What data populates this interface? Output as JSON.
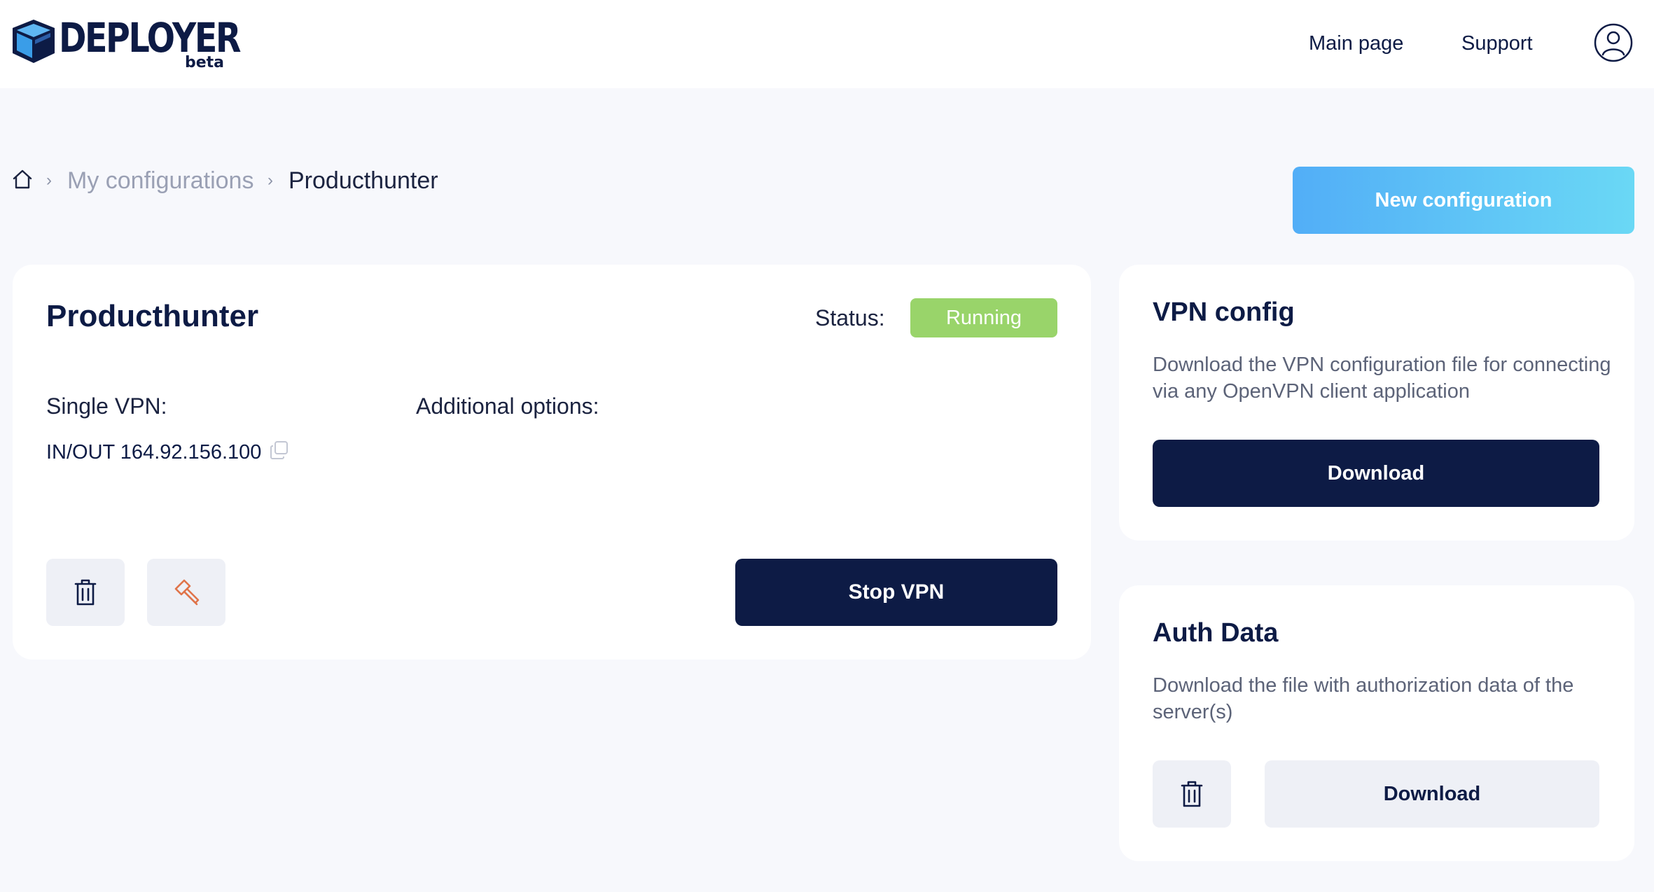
{
  "header": {
    "logo_text": "DEPLOYER",
    "logo_badge": "beta",
    "nav": [
      {
        "label": "Main page"
      },
      {
        "label": "Support"
      }
    ],
    "user_icon": "user-circle-icon"
  },
  "breadcrumb": {
    "home_icon": "home-icon",
    "items": [
      {
        "label": "My configurations"
      },
      {
        "label": "Producthunter"
      }
    ],
    "separator": "›"
  },
  "actions": {
    "new_configuration_label": "New configuration"
  },
  "configuration": {
    "name": "Producthunter",
    "status_label": "Status:",
    "status_value": "Running",
    "status_color": "#99d46a",
    "single_vpn_label": "Single VPN:",
    "additional_options_label": "Additional options:",
    "ip_line": "IN/OUT 164.92.156.100",
    "stop_label": "Stop VPN"
  },
  "vpn_config": {
    "title": "VPN config",
    "description": "Download the VPN configuration file for connecting via any OpenVPN client application",
    "download_label": "Download"
  },
  "auth_data": {
    "title": "Auth Data",
    "description": "Download the file with authorization data of the server(s)",
    "download_label": "Download"
  },
  "colors": {
    "primary_dark": "#0d1b45",
    "accent_gradient_start": "#52aef7",
    "accent_gradient_end": "#6ad8f5",
    "edit_icon": "#e0744a"
  }
}
